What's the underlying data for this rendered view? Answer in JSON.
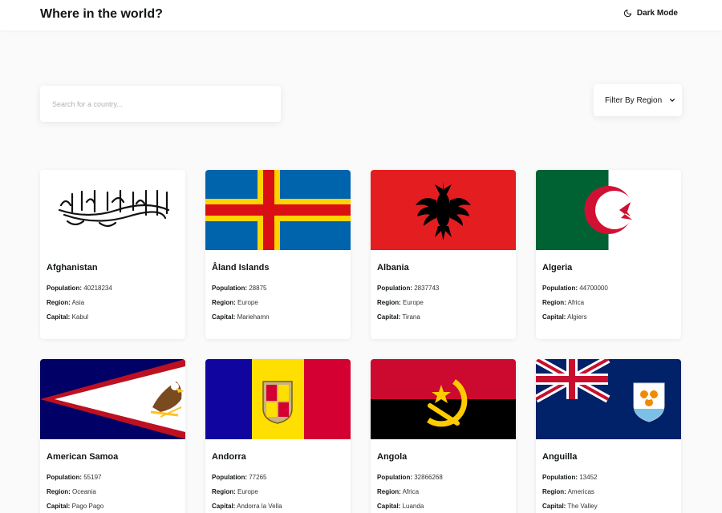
{
  "header": {
    "title": "Where in the world?",
    "dark_mode_label": "Dark Mode"
  },
  "search": {
    "placeholder": "Search for a country..."
  },
  "filter": {
    "label": "Filter By Region"
  },
  "labels": {
    "population": "Population:",
    "region": "Region:",
    "capital": "Capital:"
  },
  "countries": [
    {
      "name": "Afghanistan",
      "population": "40218234",
      "region": "Asia",
      "capital": "Kabul"
    },
    {
      "name": "Åland Islands",
      "population": "28875",
      "region": "Europe",
      "capital": "Mariehamn"
    },
    {
      "name": "Albania",
      "population": "2837743",
      "region": "Europe",
      "capital": "Tirana"
    },
    {
      "name": "Algeria",
      "population": "44700000",
      "region": "Africa",
      "capital": "Algiers"
    },
    {
      "name": "American Samoa",
      "population": "55197",
      "region": "Oceania",
      "capital": "Pago Pago"
    },
    {
      "name": "Andorra",
      "population": "77265",
      "region": "Europe",
      "capital": "Andorra la Vella"
    },
    {
      "name": "Angola",
      "population": "32866268",
      "region": "Africa",
      "capital": "Luanda"
    },
    {
      "name": "Anguilla",
      "population": "13452",
      "region": "Americas",
      "capital": "The Valley"
    }
  ]
}
